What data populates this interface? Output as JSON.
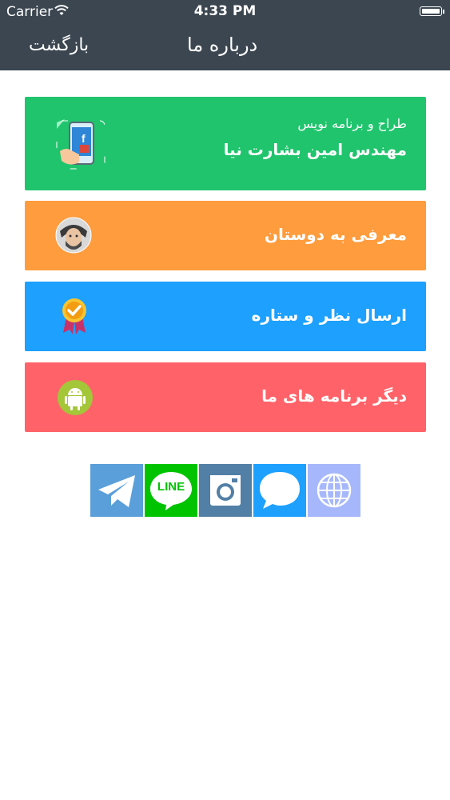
{
  "status_bar": {
    "carrier": "Carrier",
    "time": "4:33 PM"
  },
  "nav": {
    "back_label": "بازگشت",
    "title": "درباره ما"
  },
  "cards": [
    {
      "subtitle": "طراح و برنامه نویس",
      "label": "مهندس امین بشارت نیا",
      "color": "#20c46d",
      "icon": "phone-facebook-icon"
    },
    {
      "label": "معرفی به دوستان",
      "color": "#fe9c3e",
      "icon": "person-avatar-icon"
    },
    {
      "label": "ارسال نظر و ستاره",
      "color": "#1da0fe",
      "icon": "award-badge-icon"
    },
    {
      "label": "دیگر برنامه های ما",
      "color": "#ff6369",
      "icon": "android-icon"
    }
  ],
  "social": {
    "line_text": "LINE",
    "items": [
      {
        "icon": "telegram-icon",
        "color": "#5a9fd9"
      },
      {
        "icon": "line-icon",
        "color": "#00c300"
      },
      {
        "icon": "instagram-icon",
        "color": "#527fa6"
      },
      {
        "icon": "chat-bubble-icon",
        "color": "#1da0fe"
      },
      {
        "icon": "globe-icon",
        "color": "#a6b8fb"
      }
    ]
  }
}
